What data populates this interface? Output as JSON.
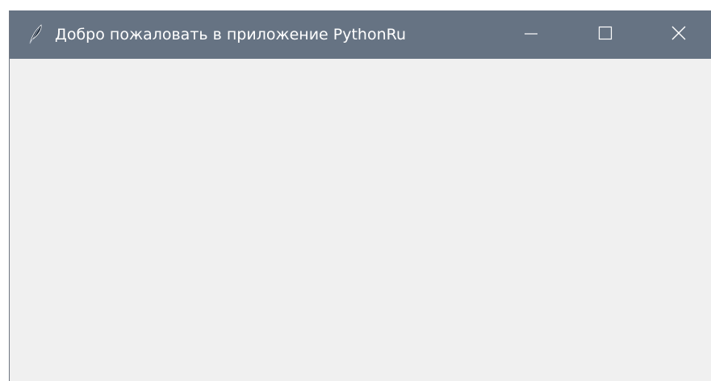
{
  "window": {
    "title": "Добро пожаловать в приложение PythonRu",
    "icon": "feather-icon",
    "controls": {
      "minimize": "minimize-icon",
      "maximize": "maximize-icon",
      "close": "close-icon"
    },
    "colors": {
      "titlebar": "#667383",
      "titlebar_text": "#ffffff",
      "client_background": "#f0f0f0"
    }
  }
}
